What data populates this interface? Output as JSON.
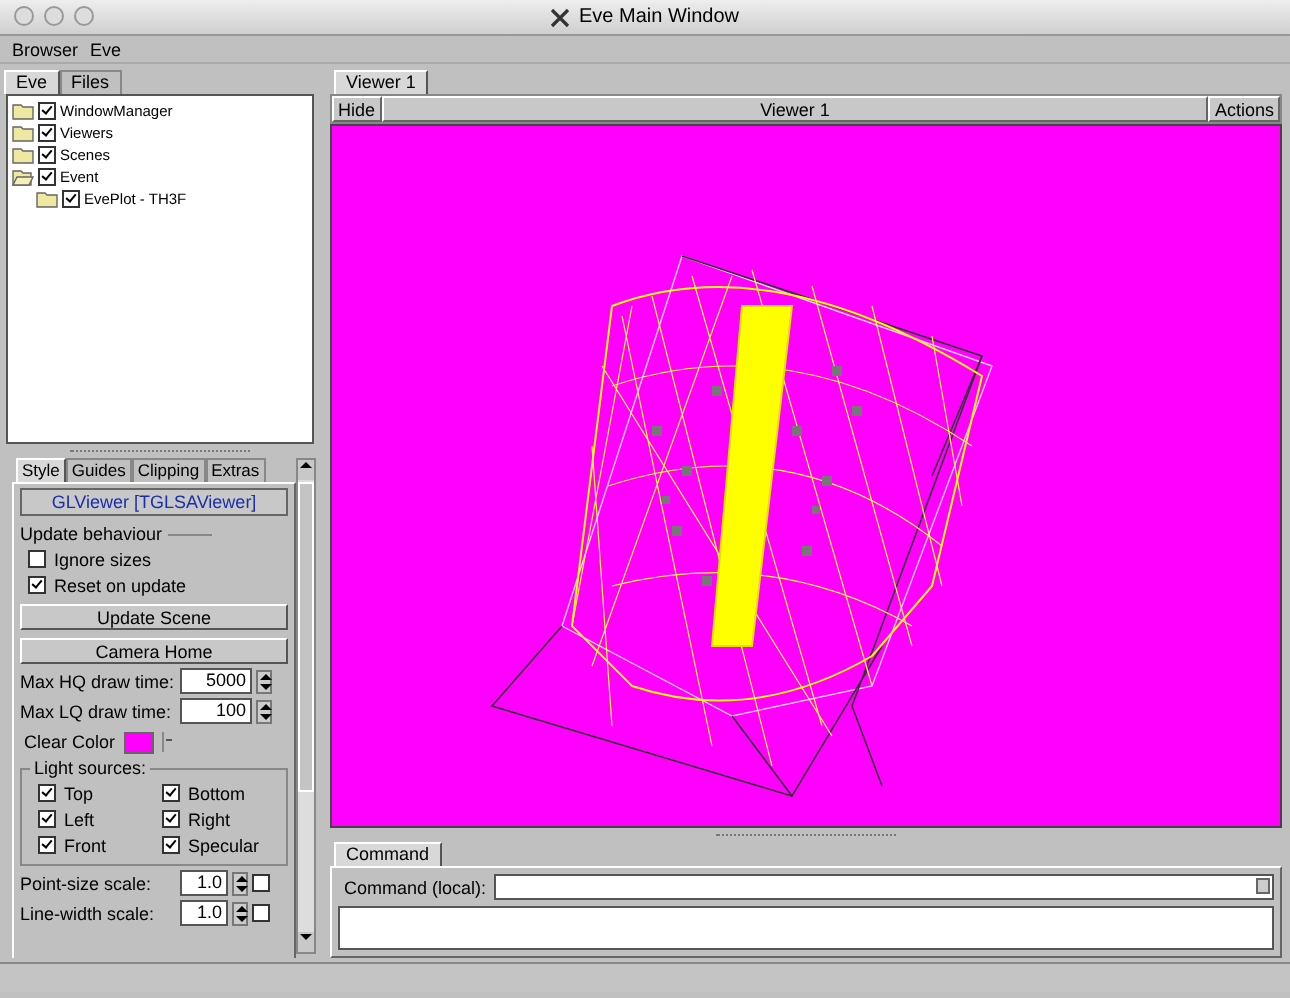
{
  "window": {
    "title": "Eve Main Window"
  },
  "menu": [
    "Browser",
    "Eve"
  ],
  "browser_tabs": [
    {
      "label": "Eve",
      "selected": true
    },
    {
      "label": "Files",
      "selected": false
    }
  ],
  "tree": [
    {
      "label": "WindowManager",
      "checked": true,
      "expanded": false
    },
    {
      "label": "Viewers",
      "checked": true,
      "expanded": false
    },
    {
      "label": "Scenes",
      "checked": true,
      "expanded": false
    },
    {
      "label": "Event",
      "checked": true,
      "expanded": true,
      "children": [
        {
          "label": "EvePlot - TH3F",
          "checked": true,
          "expanded": false
        }
      ]
    }
  ],
  "editor_tabs": [
    {
      "label": "Style",
      "selected": true
    },
    {
      "label": "Guides",
      "selected": false
    },
    {
      "label": "Clipping",
      "selected": false
    },
    {
      "label": "Extras",
      "selected": false
    }
  ],
  "object_title": "GLViewer [TGLSAViewer]",
  "update_behaviour": {
    "title": "Update behaviour",
    "options": [
      {
        "label": "Ignore sizes",
        "checked": false
      },
      {
        "label": "Reset on update",
        "checked": true
      }
    ]
  },
  "buttons": [
    "Update Scene",
    "Camera Home"
  ],
  "draw_times": [
    {
      "label": "Max HQ draw time:",
      "value": "5000"
    },
    {
      "label": "Max LQ draw time:",
      "value": "100"
    }
  ],
  "clear_color": {
    "label": "Clear Color",
    "color": "#ff00ff"
  },
  "light_sources": {
    "title": "Light sources:",
    "items": [
      {
        "label": "Top",
        "checked": true
      },
      {
        "label": "Bottom",
        "checked": true
      },
      {
        "label": "Left",
        "checked": true
      },
      {
        "label": "Right",
        "checked": true
      },
      {
        "label": "Front",
        "checked": true
      },
      {
        "label": "Specular",
        "checked": true
      }
    ]
  },
  "scales": [
    {
      "label": "Point-size scale:",
      "value": "1.0",
      "checked": false
    },
    {
      "label": "Line-width scale:",
      "value": "1.0",
      "checked": false
    }
  ],
  "viewer": {
    "tab": "Viewer 1",
    "hide": "Hide",
    "title": "Viewer 1",
    "actions": "Actions"
  },
  "command": {
    "tab": "Command",
    "label": "Command (local):"
  }
}
